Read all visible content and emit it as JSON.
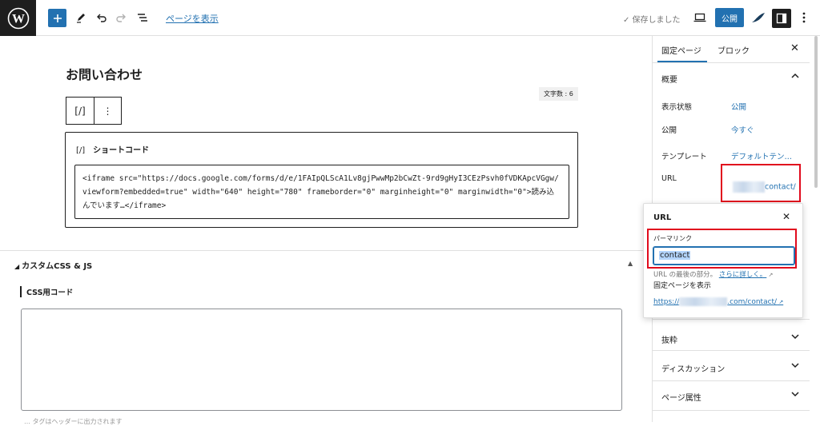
{
  "toolbar": {
    "view_page_label": "ページを表示",
    "saved_label": "✓ 保存しました",
    "publish_label": "公開"
  },
  "editor": {
    "page_title": "お問い合わせ",
    "word_count": "文字数 : 6",
    "block_toolbar": {
      "shortcode_icon": "[/]",
      "more_icon": "⋮"
    },
    "shortcode": {
      "icon": "[/]",
      "label": "ショートコード",
      "code": "<iframe src=\"https://docs.google.com/forms/d/e/1FAIpQLScA1Lv8gjPwwMp2bCwZt-9rd9gHyI3CEzPsvh0fVDKApcVGgw/viewform?embedded=true\" width=\"640\" height=\"780\" frameborder=\"0\" marginheight=\"0\" marginwidth=\"0\">読み込んでいます…</iframe>"
    }
  },
  "meta_box": {
    "title": "カスタムCSS & JS",
    "toggle_icon": "▲",
    "css_label": "CSS用コード",
    "cut_text": "… タグはヘッダーに出力されます"
  },
  "sidebar": {
    "tabs": [
      {
        "label": "固定ページ"
      },
      {
        "label": "ブロック"
      }
    ],
    "close_icon": "✕",
    "summary": {
      "title": "概要",
      "rows": [
        {
          "label": "表示状態",
          "value": "公開"
        },
        {
          "label": "公開",
          "value": "今すぐ"
        },
        {
          "label": "テンプレート",
          "value": "デフォルトテン…"
        },
        {
          "label": "URL",
          "value": "contact/"
        }
      ]
    },
    "sections": [
      {
        "label": "抜粋"
      },
      {
        "label": "ディスカッション"
      },
      {
        "label": "ページ属性"
      }
    ]
  },
  "url_popover": {
    "title": "URL",
    "close_icon": "✕",
    "permalink_label": "パーマリンク",
    "slug_value": "contact",
    "help_text": "URL の最後の部分。",
    "help_link": "さらに詳しく。",
    "view_label": "固定ページを表示",
    "link_prefix": "https://",
    "link_suffix": ".com/contact/"
  },
  "colors": {
    "accent": "#2271b1",
    "highlight_box": "#e10b1d",
    "dark": "#1e1e1e"
  },
  "icons": [
    "wordpress-logo-icon",
    "plus-icon",
    "pencil-icon",
    "undo-icon",
    "redo-icon",
    "list-view-icon",
    "desktop-preview-icon",
    "jetpack-icon",
    "sidebar-settings-icon",
    "more-vertical-icon",
    "chevron-up-icon",
    "chevron-down-icon",
    "external-link-icon"
  ]
}
